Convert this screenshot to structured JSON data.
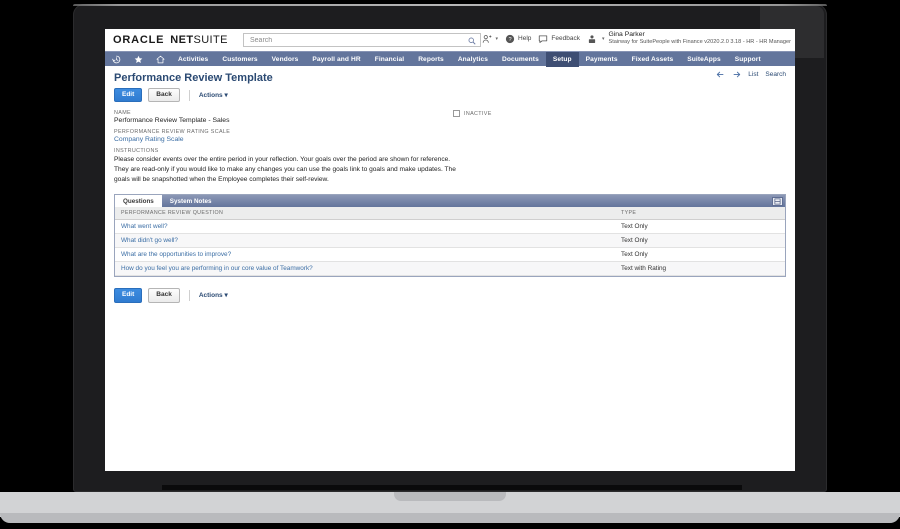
{
  "header": {
    "brand_oracle": "ORACLE",
    "brand_net": "NET",
    "brand_suite": "SUITE",
    "search_placeholder": "Search",
    "search_value": "",
    "help_label": "Help",
    "feedback_label": "Feedback",
    "user_name": "Gina Parker",
    "user_role": "Stairway for SuitePeople with Finance v2020.2.0 3.18 - HR - HR Manager"
  },
  "nav": {
    "items": [
      {
        "label": "Activities",
        "active": false
      },
      {
        "label": "Customers",
        "active": false
      },
      {
        "label": "Vendors",
        "active": false
      },
      {
        "label": "Payroll and HR",
        "active": false
      },
      {
        "label": "Financial",
        "active": false
      },
      {
        "label": "Reports",
        "active": false
      },
      {
        "label": "Analytics",
        "active": false
      },
      {
        "label": "Documents",
        "active": false
      },
      {
        "label": "Setup",
        "active": true
      },
      {
        "label": "Payments",
        "active": false
      },
      {
        "label": "Fixed Assets",
        "active": false
      },
      {
        "label": "SuiteApps",
        "active": false
      },
      {
        "label": "Support",
        "active": false
      }
    ]
  },
  "page": {
    "title": "Performance Review Template",
    "edit_label": "Edit",
    "back_label": "Back",
    "actions_label": "Actions",
    "actions_caret": "▾",
    "list_label": "List",
    "search_label": "Search"
  },
  "fields": {
    "name_label": "NAME",
    "name_value": "Performance Review Template - Sales",
    "rating_scale_label": "PERFORMANCE REVIEW RATING SCALE",
    "rating_scale_value": "Company Rating Scale",
    "inactive_label": "INACTIVE",
    "inactive_checked": false,
    "instructions_label": "INSTRUCTIONS",
    "instructions_value": "Please consider events over the entire period in your reflection. Your goals over the period are shown for reference. They are read-only if you would like to make any changes you can use the goals link to goals and make updates. The goals will be snapshotted when the Employee completes their self-review."
  },
  "panel": {
    "tabs": [
      {
        "label": "Questions",
        "active": true
      },
      {
        "label": "System Notes",
        "active": false
      }
    ],
    "columns": [
      "PERFORMANCE REVIEW QUESTION",
      "TYPE"
    ],
    "rows": [
      {
        "question": "What went well?",
        "type": "Text Only"
      },
      {
        "question": "What didn't go well?",
        "type": "Text Only"
      },
      {
        "question": "What are the opportunities to improve?",
        "type": "Text Only"
      },
      {
        "question": "How do you feel you are performing in our core value of Teamwork?",
        "type": "Text with Rating"
      }
    ]
  },
  "colors": {
    "nav_bar": "#63759c",
    "nav_active": "#3e4e73",
    "title_blue": "#2b4a73",
    "link_blue": "#3b6ea5",
    "primary_button": "#2f7bd0"
  }
}
